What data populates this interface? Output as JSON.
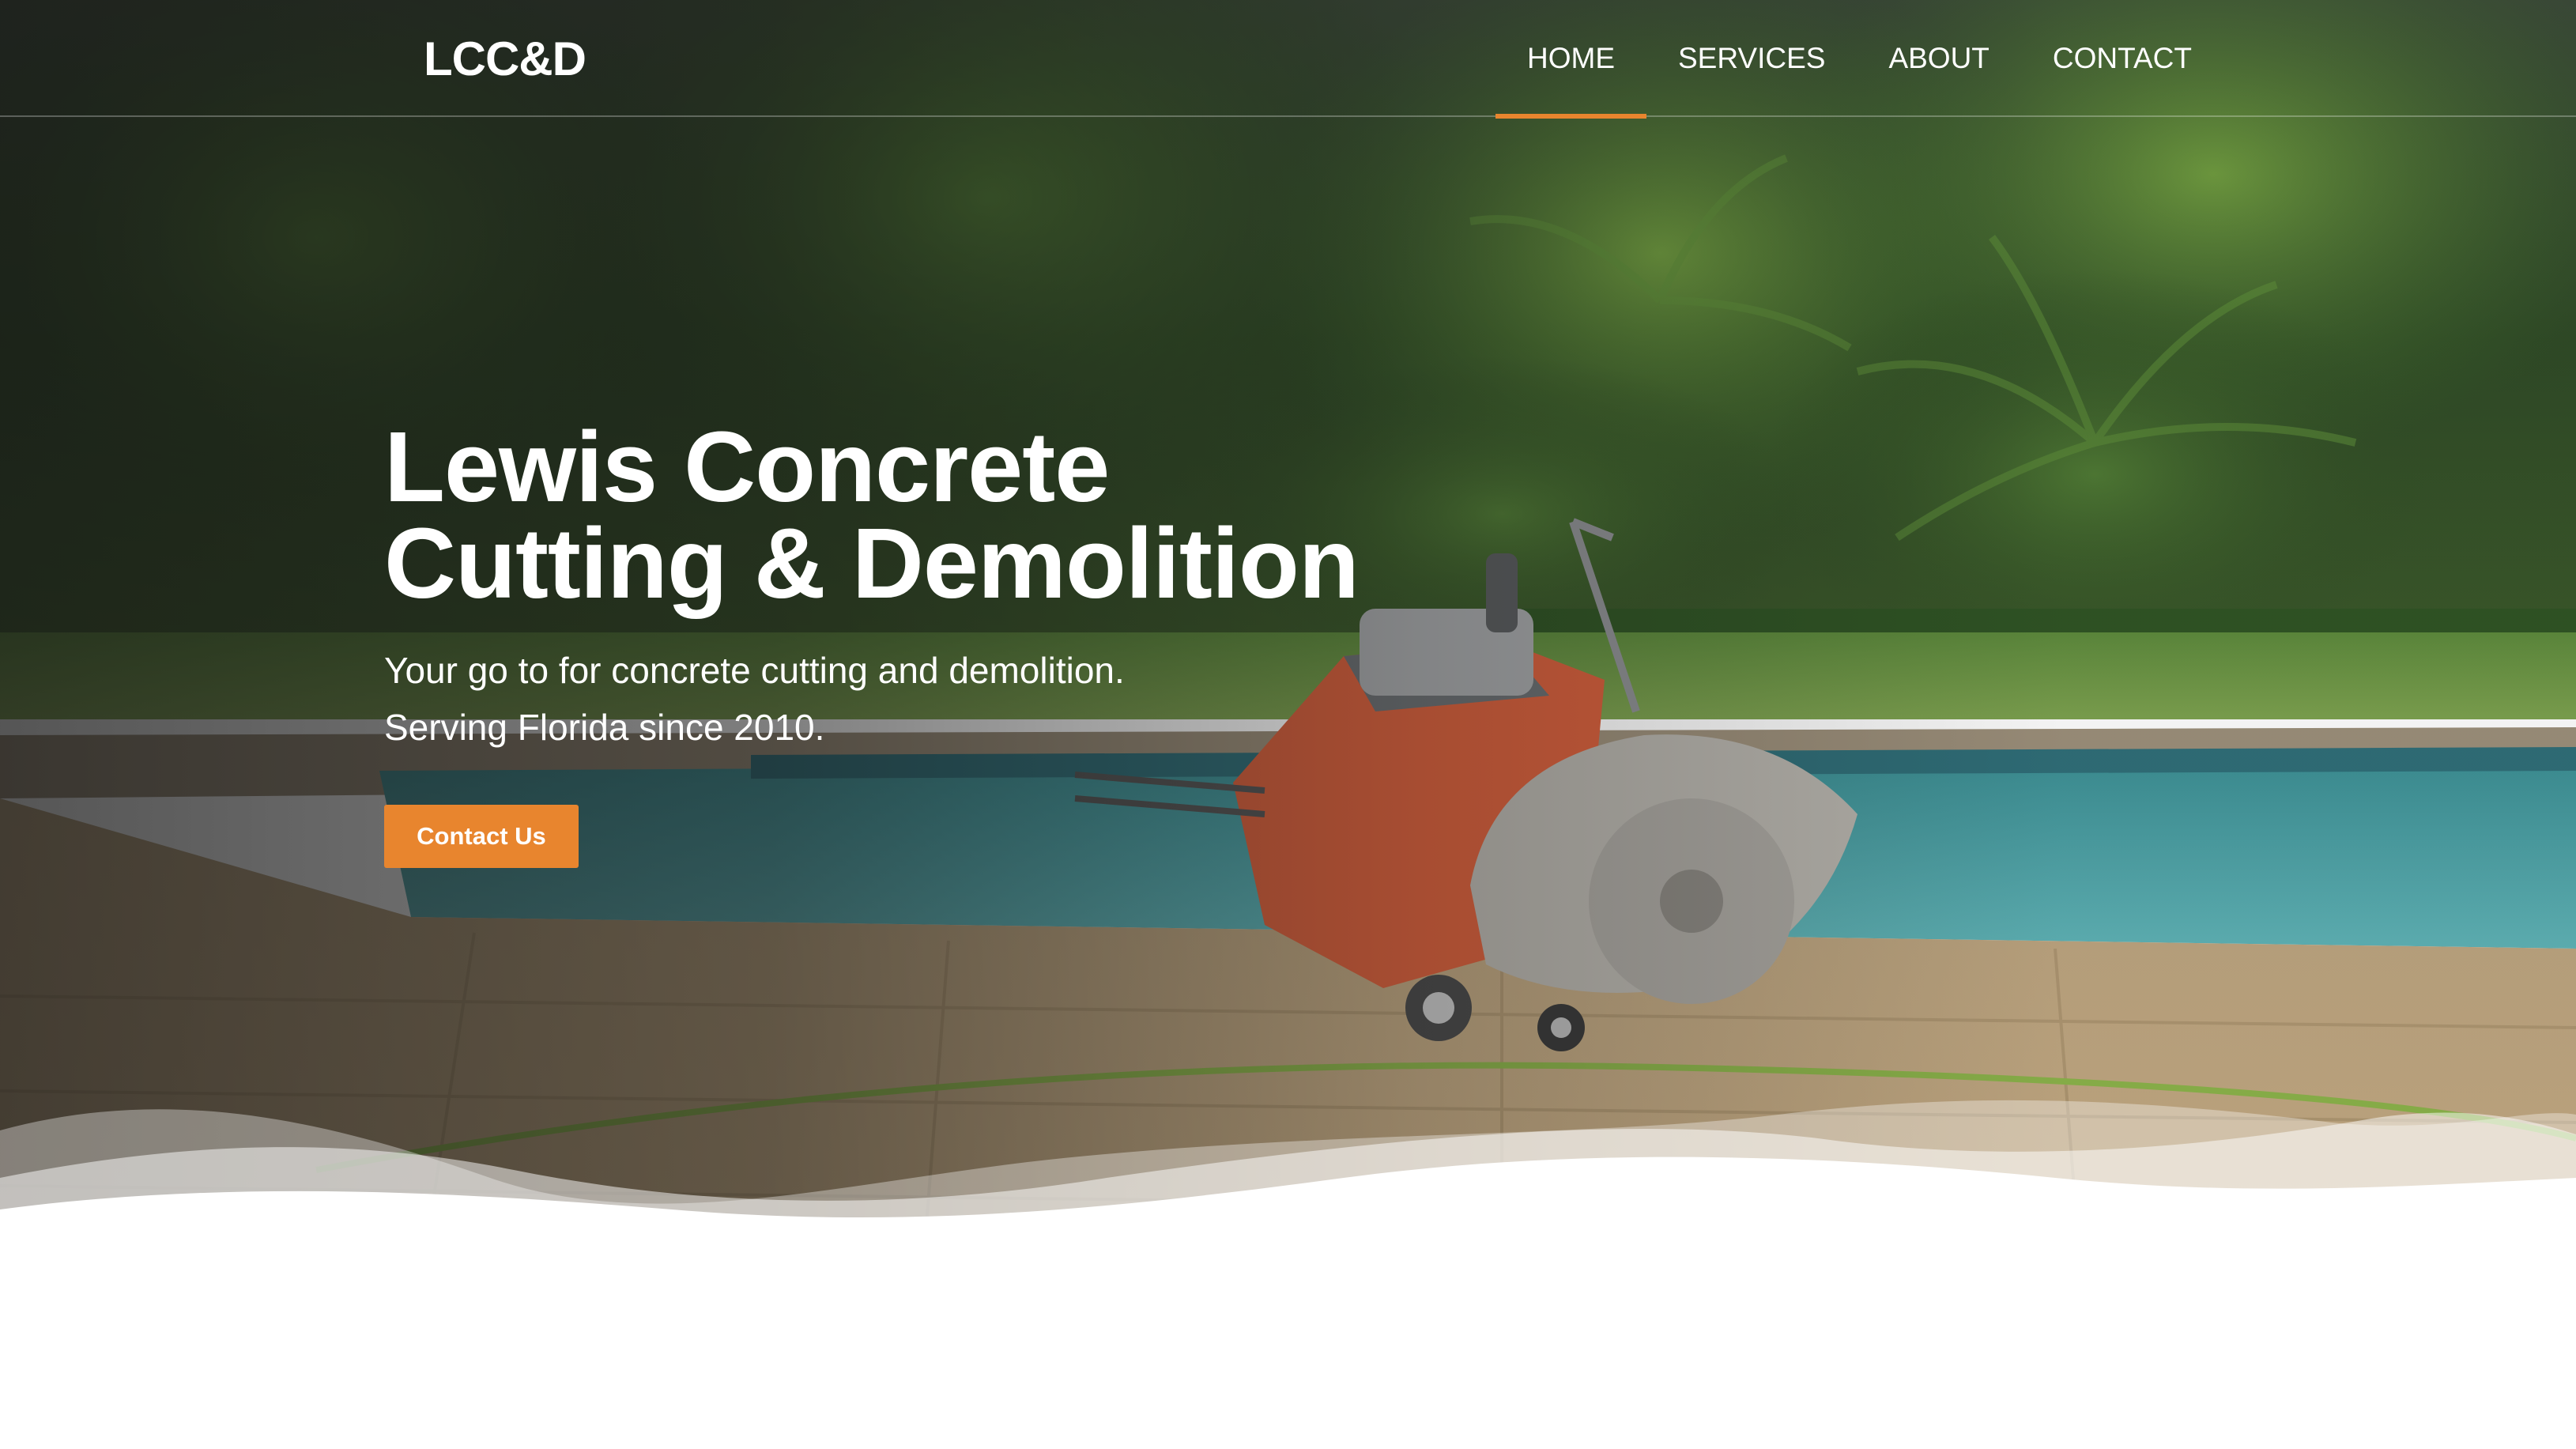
{
  "brand": {
    "logo_text": "LCC&D"
  },
  "nav": {
    "items": [
      {
        "label": "HOME",
        "active": true
      },
      {
        "label": "SERVICES",
        "active": false
      },
      {
        "label": "ABOUT",
        "active": false
      },
      {
        "label": "CONTACT",
        "active": false
      }
    ]
  },
  "hero": {
    "title_line1": "Lewis Concrete",
    "title_line2": "Cutting & Demolition",
    "subtitle_line1": "Your go to for concrete cutting and demolition.",
    "subtitle_line2": "Serving Florida since 2010.",
    "cta_label": "Contact Us"
  },
  "colors": {
    "accent": "#e8852e",
    "text": "#ffffff",
    "background": "#ffffff"
  }
}
